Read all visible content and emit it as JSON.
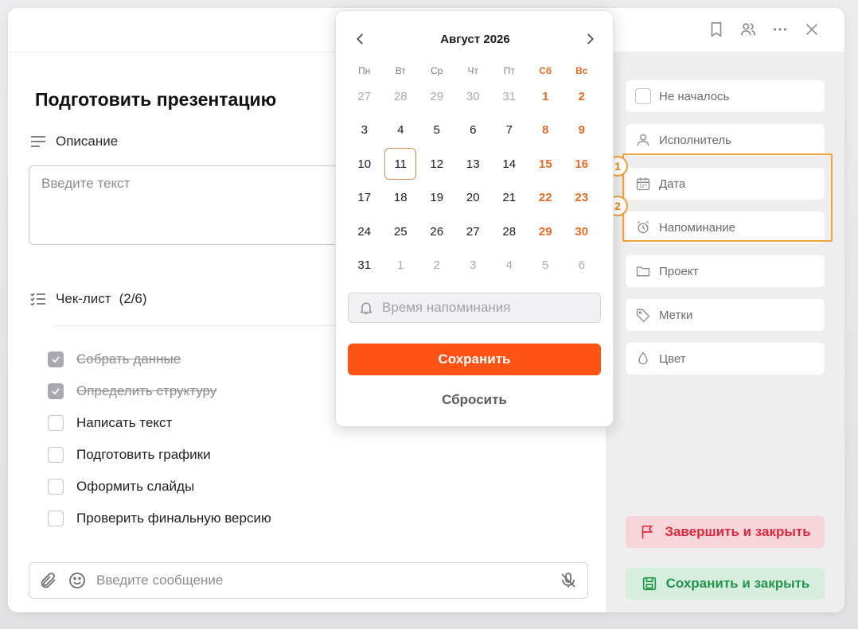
{
  "task": {
    "title": "Подготовить презентацию"
  },
  "description": {
    "heading": "Описание",
    "placeholder": "Введите текст"
  },
  "checklist": {
    "heading": "Чек-лист",
    "count": "(2/6)",
    "items": [
      {
        "label": "Собрать данные",
        "done": true
      },
      {
        "label": "Определить структуру",
        "done": true
      },
      {
        "label": "Написать текст",
        "done": false
      },
      {
        "label": "Подготовить графики",
        "done": false
      },
      {
        "label": "Оформить слайды",
        "done": false
      },
      {
        "label": "Проверить финальную версию",
        "done": false
      }
    ]
  },
  "message": {
    "placeholder": "Введите сообщение"
  },
  "sidebar": {
    "status": "Не началось",
    "assignee": "Исполнитель",
    "date": "Дата",
    "reminder": "Напоминание",
    "project": "Проект",
    "tags": "Метки",
    "color": "Цвет",
    "finish_label": "Завершить и закрыть",
    "save_close_label": "Сохранить и закрыть"
  },
  "annotation": {
    "marker1": "1",
    "marker2": "2",
    "color": "#f3a23b"
  },
  "calendar": {
    "month_label": "Август 2026",
    "weekdays": [
      "Пн",
      "Вт",
      "Ср",
      "Чт",
      "Пт",
      "Сб",
      "Вс"
    ],
    "weeks": [
      [
        "27",
        "28",
        "29",
        "30",
        "31",
        "1",
        "2"
      ],
      [
        "3",
        "4",
        "5",
        "6",
        "7",
        "8",
        "9"
      ],
      [
        "10",
        "11",
        "12",
        "13",
        "14",
        "15",
        "16"
      ],
      [
        "17",
        "18",
        "19",
        "20",
        "21",
        "22",
        "23"
      ],
      [
        "24",
        "25",
        "26",
        "27",
        "28",
        "29",
        "30"
      ],
      [
        "31",
        "1",
        "2",
        "3",
        "4",
        "5",
        "6"
      ]
    ],
    "today": "11",
    "reminder_placeholder": "Время напоминания",
    "save_label": "Сохранить",
    "reset_label": "Сбросить"
  },
  "colors": {
    "accent": "#ff5316",
    "weekend": "#e86a23",
    "finish_bg": "#f7d6db",
    "finish_text": "#e0283d",
    "save_bg": "#d6eedd",
    "save_text": "#22954a"
  },
  "icons": [
    "bookmark-icon",
    "users-icon",
    "more-icon",
    "close-icon",
    "description-icon",
    "checklist-icon",
    "attach-icon",
    "emoji-icon",
    "mic-off-icon",
    "user-icon",
    "calendar-icon",
    "alarm-icon",
    "folder-icon",
    "tag-icon",
    "drop-icon",
    "flag-icon",
    "floppy-icon",
    "bell-icon",
    "chevron-left-icon",
    "chevron-right-icon"
  ]
}
